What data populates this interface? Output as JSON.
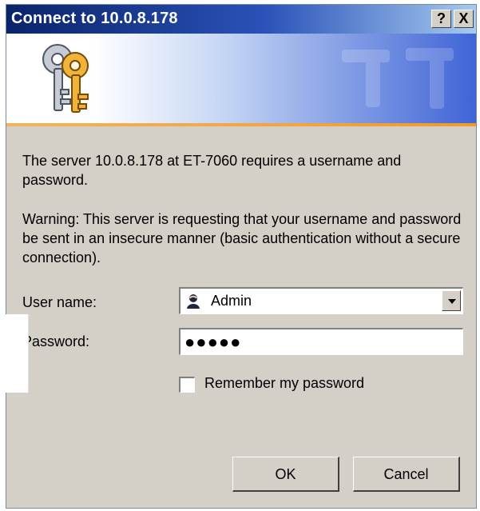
{
  "window": {
    "title": "Connect to 10.0.8.178",
    "help_glyph": "?",
    "close_glyph": "X",
    "banner_icon": "keys-icon"
  },
  "body": {
    "intro": "The server 10.0.8.178 at ET-7060 requires a username and password.",
    "warning": "Warning: This server is requesting that your username and password be sent in an insecure manner (basic authentication without a secure connection)."
  },
  "form": {
    "username_label": "User name:",
    "username_value": "Admin",
    "password_label": "Password:",
    "password_value": "●●●●●",
    "remember_label": "Remember my password",
    "remember_checked": false
  },
  "buttons": {
    "ok": "OK",
    "cancel": "Cancel"
  },
  "colors": {
    "titlebar_start": "#0a246a",
    "titlebar_end": "#a6caf0",
    "dialog_face": "#d4d0c8",
    "banner_accent": "#f09a2d"
  }
}
